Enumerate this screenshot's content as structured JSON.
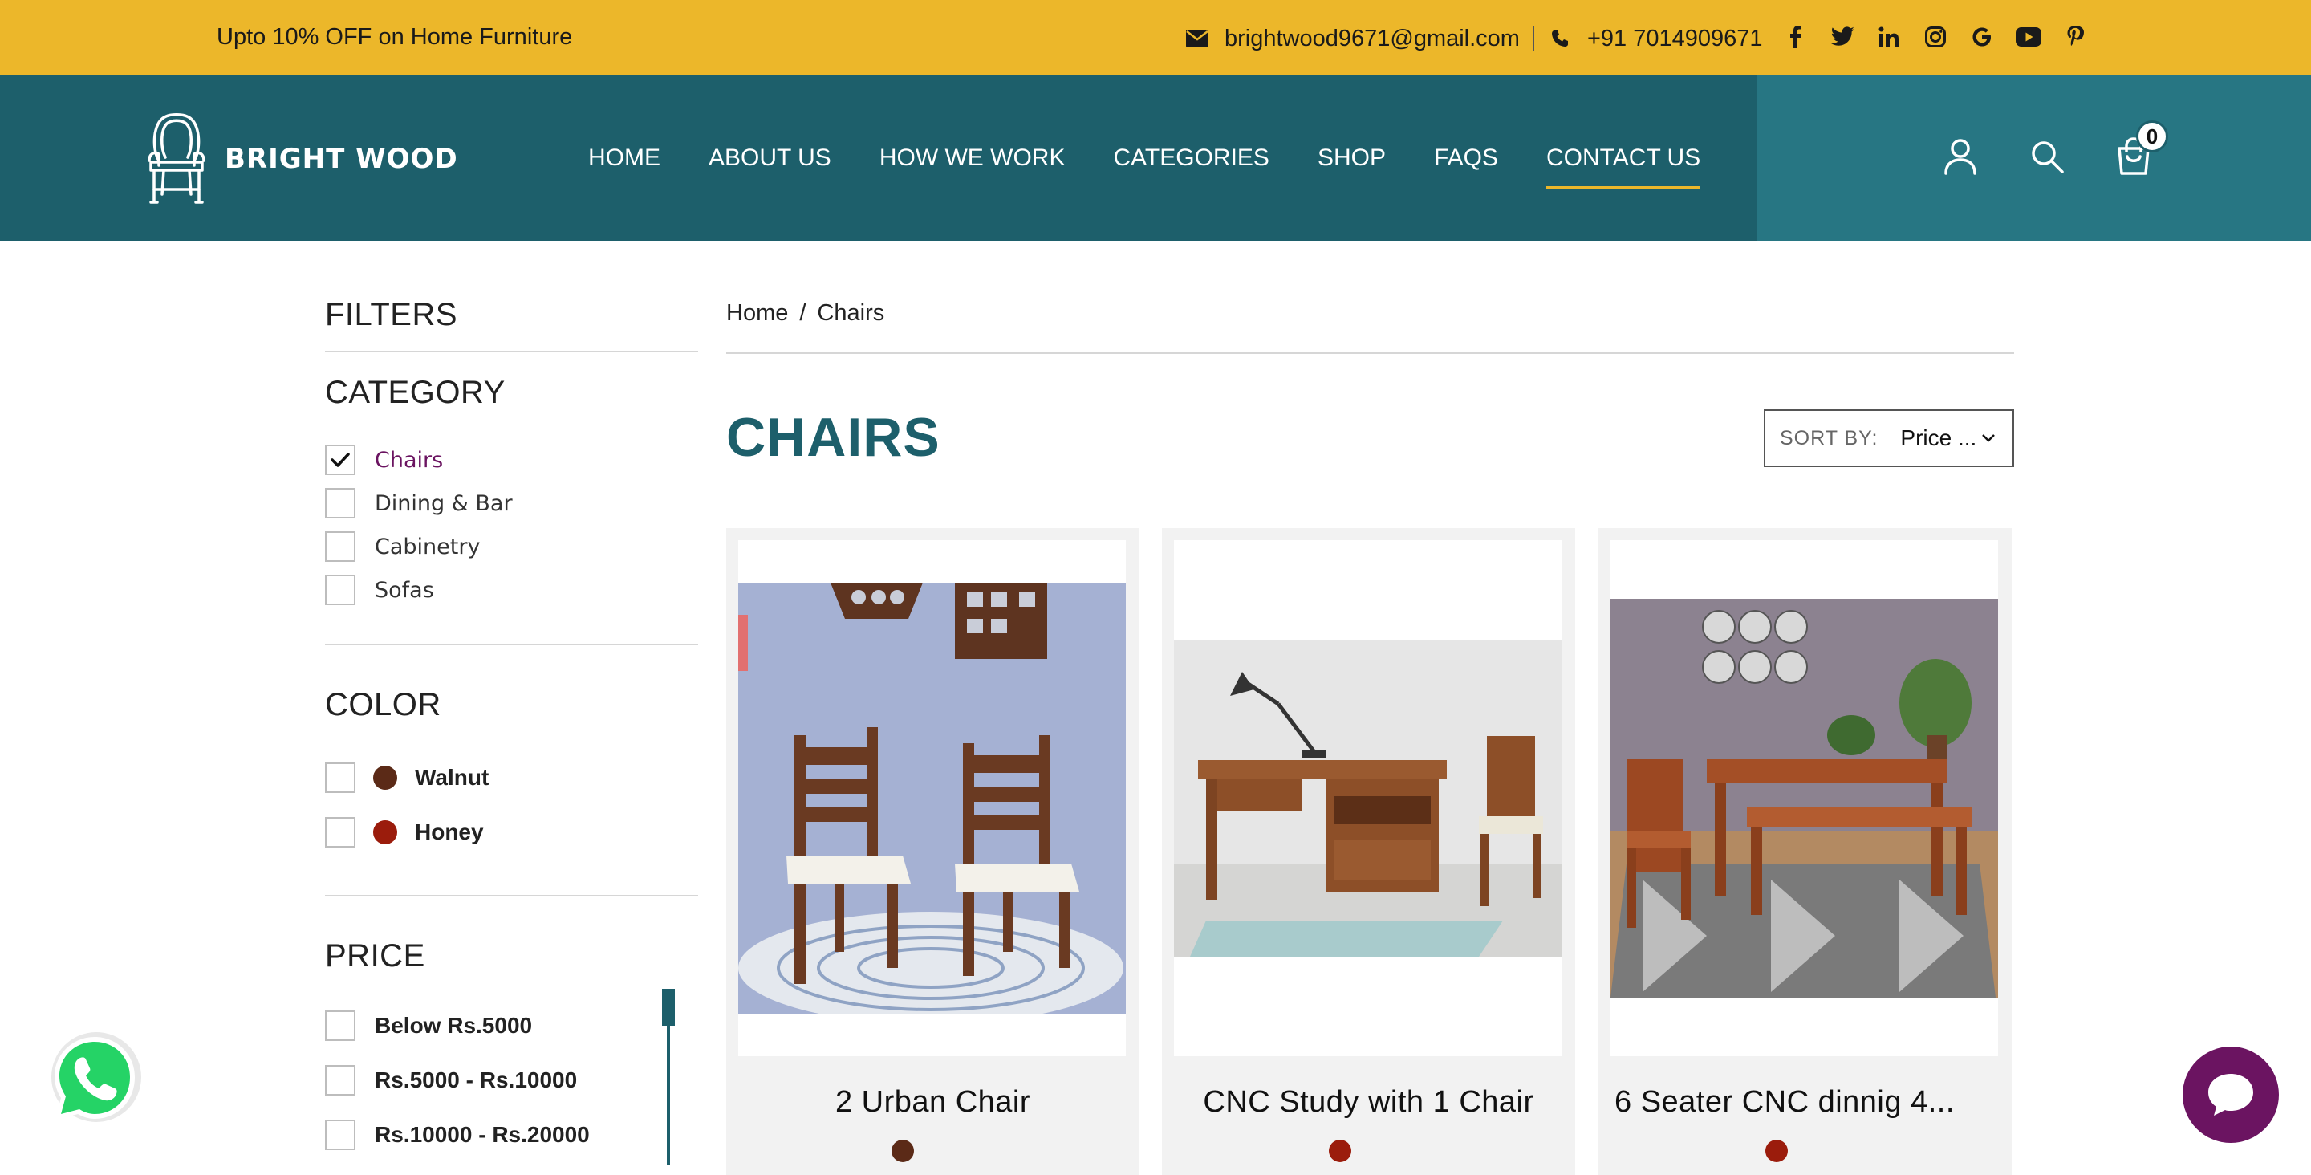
{
  "topbar": {
    "promo": "Upto 10% OFF on Home Furniture",
    "email": "brightwood9671@gmail.com",
    "phone": "+91 7014909671",
    "socials": [
      "facebook-icon",
      "twitter-icon",
      "linkedin-icon",
      "instagram-icon",
      "google-icon",
      "youtube-icon",
      "pinterest-icon"
    ]
  },
  "header": {
    "logo_text": "BRIGHT WOOD",
    "nav": [
      "HOME",
      "ABOUT US",
      "HOW WE WORK",
      "CATEGORIES",
      "SHOP",
      "FAQS",
      "CONTACT US"
    ],
    "active_nav": "CONTACT US",
    "cart_count": "0"
  },
  "filters": {
    "title": "FILTERS",
    "category": {
      "title": "CATEGORY",
      "items": [
        {
          "label": "Chairs",
          "checked": true
        },
        {
          "label": "Dining & Bar",
          "checked": false
        },
        {
          "label": "Cabinetry",
          "checked": false
        },
        {
          "label": "Sofas",
          "checked": false
        }
      ]
    },
    "color": {
      "title": "COLOR",
      "items": [
        {
          "label": "Walnut",
          "swatch": "#5b2a17"
        },
        {
          "label": "Honey",
          "swatch": "#9b1c0c"
        }
      ]
    },
    "price": {
      "title": "PRICE",
      "items": [
        "Below Rs.5000",
        "Rs.5000 - Rs.10000",
        "Rs.10000 - Rs.20000"
      ]
    }
  },
  "breadcrumb": {
    "home": "Home",
    "separator": "/",
    "current": "Chairs"
  },
  "page_title": "CHAIRS",
  "sort": {
    "label": "SORT BY:",
    "value": "Price ..."
  },
  "products": [
    {
      "title": "2 Urban Chair",
      "color": "#5b2a17"
    },
    {
      "title": "CNC Study with 1 Chair",
      "color": "#9b1c0c"
    },
    {
      "title": "6 Seater CNC dinnig 4...",
      "color": "#9b1c0c"
    }
  ],
  "colors": {
    "topbar": "#ecb72a",
    "header": "#1d5f6b",
    "accent": "#ecb72a",
    "selected_category": "#6b1461",
    "chat": "#6b1461",
    "whatsapp": "#25d366"
  }
}
